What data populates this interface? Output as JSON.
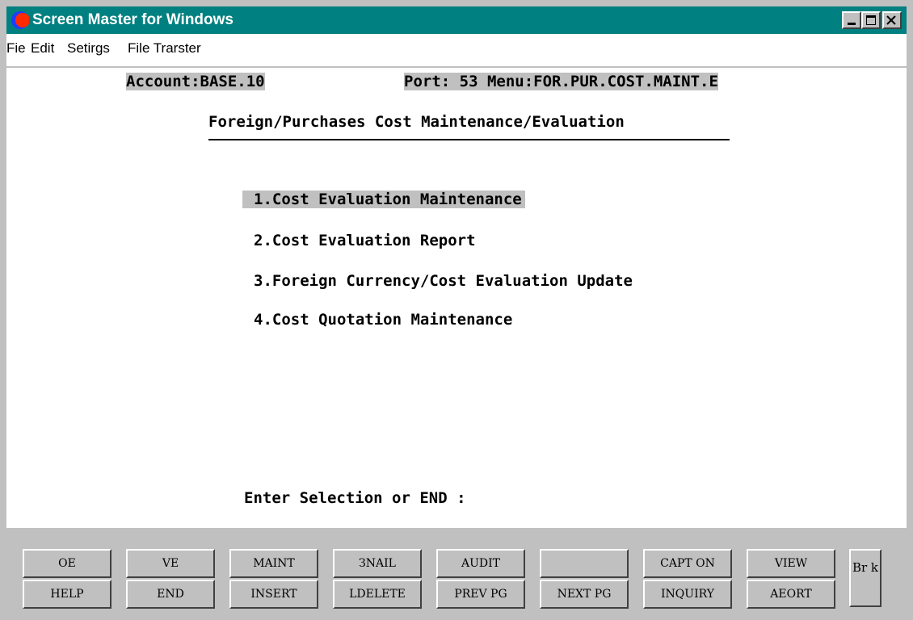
{
  "window": {
    "title": "Screen Master for Windows"
  },
  "menu": {
    "items": [
      "Fie",
      "Edit",
      "Setirgs",
      "File Trarster"
    ]
  },
  "terminal": {
    "header_left": "Account:BASE.10",
    "header_right": "Port: 53 Menu:FOR.PUR.COST.MAINT.E",
    "title": "Foreign/Purchases Cost Maintenance/Evaluation",
    "options": [
      "1.Cost Evaluation Maintenance",
      "2.Cost Evaluation Report",
      "3.Foreign Currency/Cost Evaluation Update",
      "4.Cost Quotation Maintenance"
    ],
    "prompt": "Enter Selection or END :"
  },
  "fkeys": {
    "row1": [
      "OE",
      "VE",
      "MAINT",
      "ЗNAIL",
      "AUDIT",
      "",
      "CAPT ON",
      "VIEW"
    ],
    "row2": [
      "HELP",
      "END",
      "INSERT",
      "LDELETE",
      "PREV PG",
      "NEXT PG",
      "INQUIRY",
      "AEORT"
    ],
    "extra": "Br k"
  }
}
